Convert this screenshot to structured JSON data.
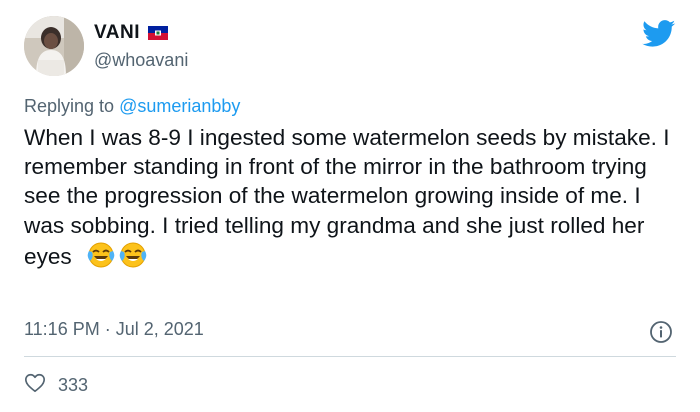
{
  "user": {
    "display_name": "VANI",
    "handle": "@whoavani",
    "flag_icon": "haiti-flag-icon"
  },
  "reply": {
    "prefix": "Replying to",
    "mention": "@sumerianbby"
  },
  "tweet": {
    "text": "When I was 8-9 I ingested some watermelon seeds by mistake. I remember standing in front of the mirror in the bathroom trying see the progression of the watermelon growing inside of me. I was sobbing. I tried telling my grandma and she just rolled her eyes",
    "emojis": [
      "face-with-tears-of-joy-icon",
      "face-with-tears-of-joy-icon"
    ]
  },
  "meta": {
    "timestamp": "11:16 PM · Jul 2, 2021"
  },
  "engagement": {
    "likes": "333"
  },
  "colors": {
    "twitter_blue": "#1d9bf0",
    "secondary_text": "#536471",
    "primary_text": "#0f1419",
    "divider": "#cfd9de"
  },
  "icons": {
    "logo": "twitter-bird-icon",
    "info": "info-icon",
    "like": "heart-icon"
  }
}
